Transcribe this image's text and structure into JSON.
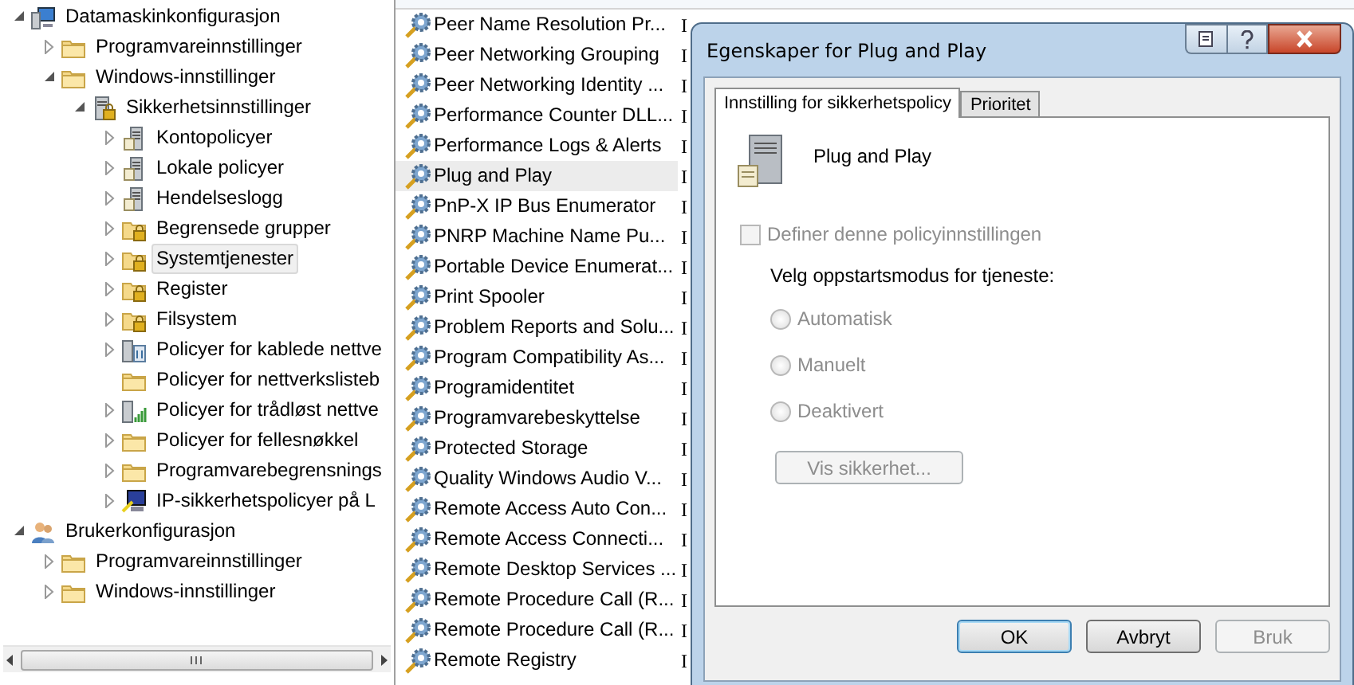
{
  "tree": [
    {
      "label": "Datamaskinkonfigurasjon",
      "kind": "computer",
      "expanded": true,
      "selected": false,
      "children": [
        {
          "label": "Programvareinnstillinger",
          "kind": "folder",
          "expanded": false,
          "selected": false
        },
        {
          "label": "Windows-innstillinger",
          "kind": "folder",
          "expanded": true,
          "selected": false,
          "children": [
            {
              "label": "Sikkerhetsinnstillinger",
              "kind": "secure",
              "expanded": true,
              "selected": false,
              "children": [
                {
                  "label": "Kontopolicyer",
                  "kind": "server",
                  "expanded": false,
                  "selected": false
                },
                {
                  "label": "Lokale policyer",
                  "kind": "server",
                  "expanded": false,
                  "selected": false
                },
                {
                  "label": "Hendelseslogg",
                  "kind": "server",
                  "expanded": false,
                  "selected": false
                },
                {
                  "label": "Begrensede grupper",
                  "kind": "lockfolder",
                  "expanded": false,
                  "selected": false
                },
                {
                  "label": "Systemtjenester",
                  "kind": "lockfolder",
                  "expanded": false,
                  "selected": true
                },
                {
                  "label": "Register",
                  "kind": "lockfolder",
                  "expanded": false,
                  "selected": false
                },
                {
                  "label": "Filsystem",
                  "kind": "lockfolder",
                  "expanded": false,
                  "selected": false
                },
                {
                  "label": "Policyer for kablede nettve",
                  "kind": "network",
                  "expanded": false,
                  "selected": false
                },
                {
                  "label": "Policyer for nettverkslisteb",
                  "kind": "folder",
                  "selected": false
                },
                {
                  "label": "Policyer for trådløst nettve",
                  "kind": "wireless",
                  "expanded": false,
                  "selected": false
                },
                {
                  "label": "Policyer for fellesnøkkel",
                  "kind": "folder",
                  "expanded": false,
                  "selected": false
                },
                {
                  "label": "Programvarebegrensnings",
                  "kind": "folder",
                  "expanded": false,
                  "selected": false
                },
                {
                  "label": "IP-sikkerhetspolicyer på L",
                  "kind": "ipsec",
                  "expanded": false,
                  "selected": false
                }
              ]
            }
          ]
        }
      ]
    },
    {
      "label": "Brukerkonfigurasjon",
      "kind": "user",
      "expanded": true,
      "selected": false,
      "children": [
        {
          "label": "Programvareinnstillinger",
          "kind": "folder",
          "expanded": false,
          "selected": false
        },
        {
          "label": "Windows-innstillinger",
          "kind": "folder",
          "expanded": false,
          "selected": false
        }
      ]
    }
  ],
  "services": [
    {
      "name": "Peer Name Resolution Pr...",
      "column_2": "I",
      "selected": false
    },
    {
      "name": "Peer Networking Grouping",
      "column_2": "I",
      "selected": false
    },
    {
      "name": "Peer Networking Identity ...",
      "column_2": "I",
      "selected": false
    },
    {
      "name": "Performance Counter DLL...",
      "column_2": "I",
      "selected": false
    },
    {
      "name": "Performance Logs & Alerts",
      "column_2": "I",
      "selected": false
    },
    {
      "name": "Plug and Play",
      "column_2": "I",
      "selected": true
    },
    {
      "name": "PnP-X IP Bus Enumerator",
      "column_2": "I",
      "selected": false
    },
    {
      "name": "PNRP Machine Name Pu...",
      "column_2": "I",
      "selected": false
    },
    {
      "name": "Portable Device Enumerat...",
      "column_2": "I",
      "selected": false
    },
    {
      "name": "Print Spooler",
      "column_2": "I",
      "selected": false
    },
    {
      "name": "Problem Reports and Solu...",
      "column_2": "I",
      "selected": false
    },
    {
      "name": "Program Compatibility As...",
      "column_2": "I",
      "selected": false
    },
    {
      "name": "Programidentitet",
      "column_2": "I",
      "selected": false
    },
    {
      "name": "Programvarebeskyttelse",
      "column_2": "I",
      "selected": false
    },
    {
      "name": "Protected Storage",
      "column_2": "I",
      "selected": false
    },
    {
      "name": "Quality Windows Audio V...",
      "column_2": "I",
      "selected": false
    },
    {
      "name": "Remote Access Auto Con...",
      "column_2": "I",
      "selected": false
    },
    {
      "name": "Remote Access Connecti...",
      "column_2": "I",
      "selected": false
    },
    {
      "name": "Remote Desktop Services ...",
      "column_2": "I",
      "selected": false
    },
    {
      "name": "Remote Procedure Call (R...",
      "column_2": "I",
      "selected": false
    },
    {
      "name": "Remote Procedure Call (R...",
      "column_2": "I",
      "selected": false
    },
    {
      "name": "Remote Registry",
      "column_2": "I",
      "selected": false
    }
  ],
  "dialog": {
    "title": "Egenskaper for Plug and Play",
    "tabs": [
      {
        "label": "Innstilling for sikkerhetspolicy",
        "selected": true
      },
      {
        "label": "Prioritet",
        "selected": false
      }
    ],
    "service_name": "Plug and Play",
    "define_checkbox": {
      "label": "Definer denne policyinnstillingen",
      "checked": false,
      "disabled": true
    },
    "startup_label": "Velg oppstartsmodus for tjeneste:",
    "startup_options": [
      {
        "label": "Automatisk",
        "selected": false,
        "disabled": true
      },
      {
        "label": "Manuelt",
        "selected": false,
        "disabled": true
      },
      {
        "label": "Deaktivert",
        "selected": false,
        "disabled": true
      }
    ],
    "security_button": {
      "label": "Vis sikkerhet...",
      "disabled": true
    },
    "buttons": [
      {
        "label": "OK",
        "disabled": false,
        "default": true
      },
      {
        "label": "Avbryt",
        "disabled": false,
        "default": false
      },
      {
        "label": "Bruk",
        "disabled": true,
        "default": false
      }
    ]
  }
}
